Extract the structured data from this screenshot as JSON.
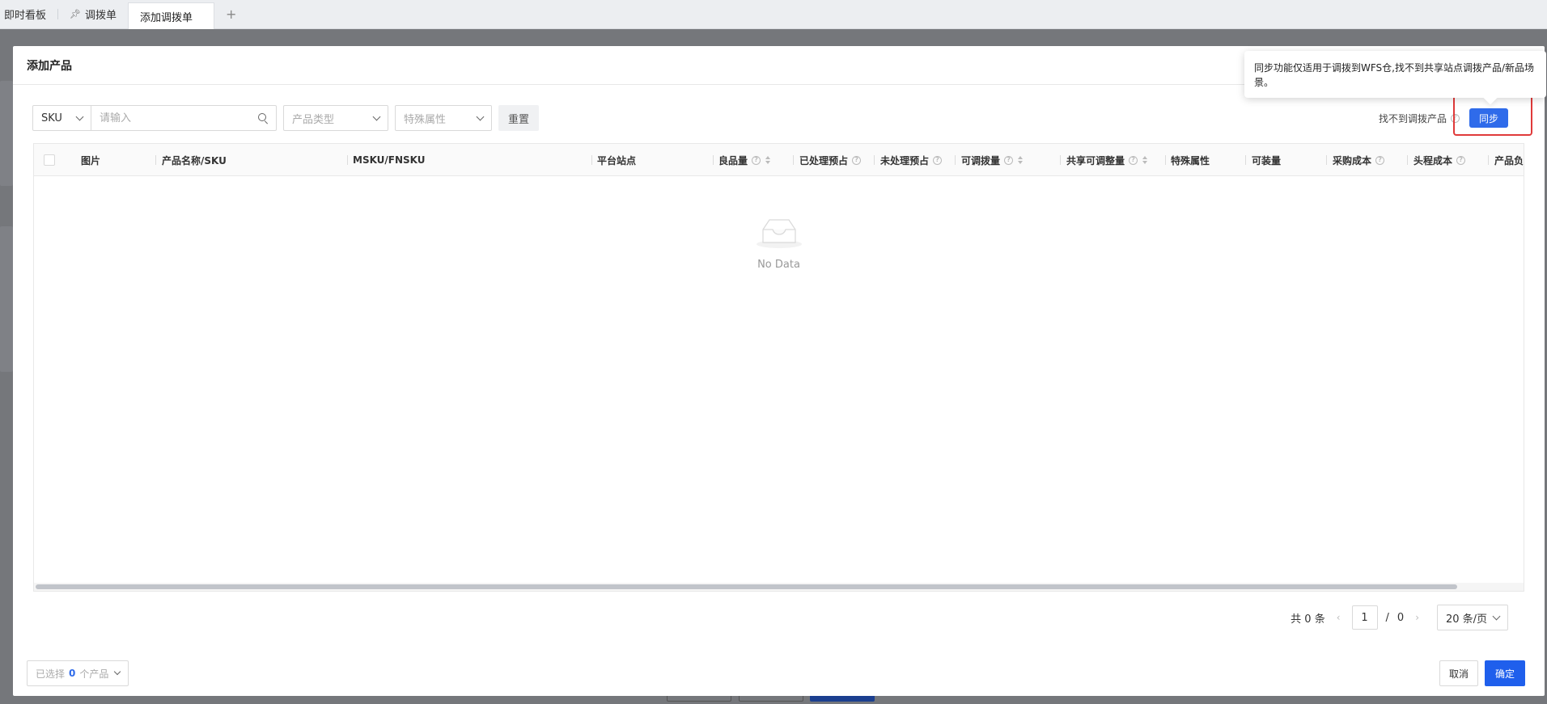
{
  "tabs": {
    "items": [
      {
        "label": "即时看板"
      },
      {
        "label": "调拨单"
      },
      {
        "label": "添加调拨单"
      }
    ],
    "add_label": "+"
  },
  "modal": {
    "title": "添加产品"
  },
  "filters": {
    "field_select": "SKU",
    "search_placeholder": "请输入",
    "product_type_placeholder": "产品类型",
    "special_attr_placeholder": "特殊属性",
    "reset_label": "重置"
  },
  "sync": {
    "label": "找不到调拨产品",
    "button_label": "同步",
    "tooltip": "同步功能仅适用于调拨到WFS仓,找不到共享站点调拨产品/新品场景。"
  },
  "table": {
    "columns": [
      {
        "label": "图片"
      },
      {
        "label": "产品名称/SKU"
      },
      {
        "label": "MSKU/FNSKU"
      },
      {
        "label": "平台站点"
      },
      {
        "label": "良品量"
      },
      {
        "label": "已处理预占"
      },
      {
        "label": "未处理预占"
      },
      {
        "label": "可调拨量"
      },
      {
        "label": "共享可调整量"
      },
      {
        "label": "特殊属性"
      },
      {
        "label": "可装量"
      },
      {
        "label": "采购成本"
      },
      {
        "label": "头程成本"
      },
      {
        "label": "产品负"
      }
    ],
    "empty_text": "No Data"
  },
  "pagination": {
    "total_text": "共 0 条",
    "prev": "‹",
    "current_page": "1",
    "separator": "/",
    "total_pages": "0",
    "next": "›",
    "page_size": "20 条/页"
  },
  "footer": {
    "selected_prefix": "已选择",
    "selected_count": "0",
    "selected_suffix": "个产品",
    "cancel_label": "取消",
    "ok_label": "确定"
  },
  "colors": {
    "primary": "#2f6bea",
    "highlight": "#e03a3a"
  }
}
